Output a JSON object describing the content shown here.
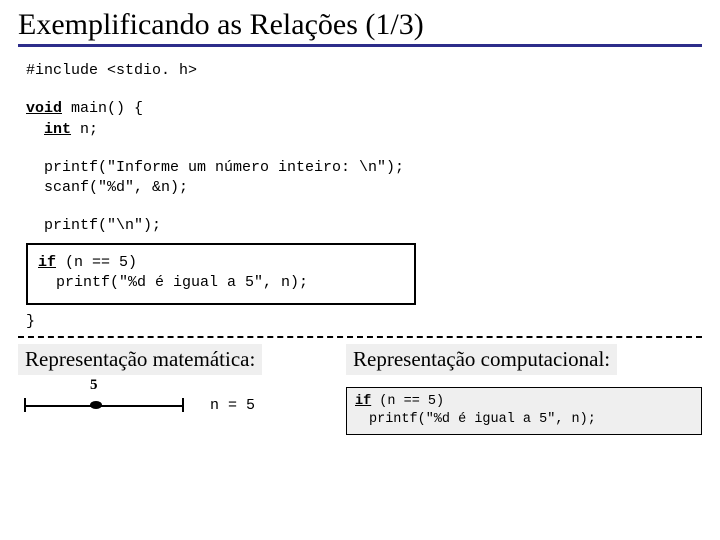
{
  "title": "Exemplificando as Relações (1/3)",
  "code": {
    "include": "#include <stdio. h>",
    "void": "void",
    "main_sig": " main() {",
    "int": "int",
    "decl_n": " n;",
    "printf1": "printf(\"Informe um número inteiro: \\n\");",
    "scanf": "scanf(\"%d\", &n);",
    "printf2": "printf(\"\\n\");",
    "if": "if",
    "if_cond": " (n == 5)",
    "if_body": "printf(\"%d é igual a 5\", n);",
    "close": "}"
  },
  "math_label": "Representação matemática:",
  "comp_label": "Representação computacional:",
  "axis": {
    "value": "5",
    "equation": "n = 5"
  },
  "comp_box": {
    "if": "if",
    "cond": " (n == 5)",
    "body": "printf(\"%d é igual a 5\", n);"
  },
  "chart_data": {
    "type": "line",
    "title": "Number line at n = 5",
    "x": [
      5
    ],
    "values": [
      0
    ],
    "xlabel": "",
    "ylabel": "",
    "ylim": [
      0,
      0
    ]
  }
}
